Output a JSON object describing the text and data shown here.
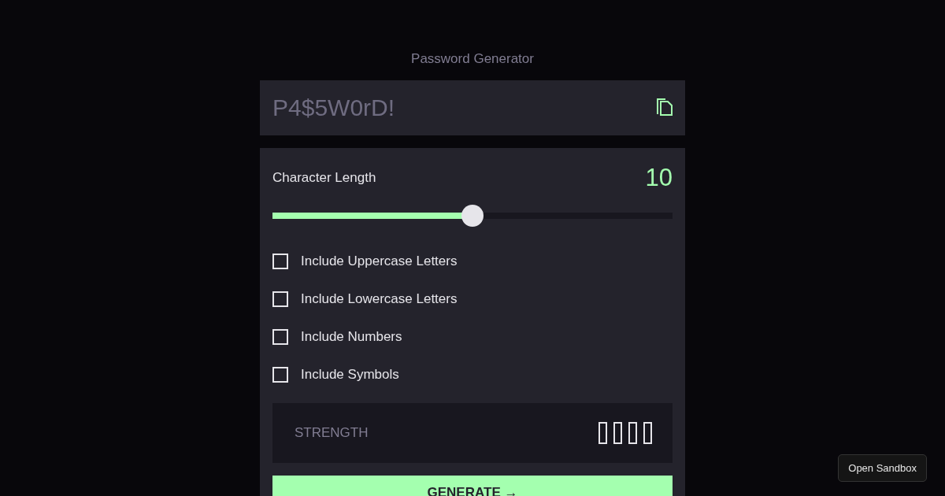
{
  "title": "Password Generator",
  "password": {
    "value": "P4$5W0rD!"
  },
  "length": {
    "label": "Character Length",
    "value": "10",
    "level": 0.5
  },
  "options": [
    {
      "label": "Include Uppercase Letters",
      "checked": false
    },
    {
      "label": "Include Lowercase Letters",
      "checked": false
    },
    {
      "label": "Include Numbers",
      "checked": false
    },
    {
      "label": "Include Symbols",
      "checked": false
    }
  ],
  "strength": {
    "label": "STRENGTH",
    "bars": [
      {
        "filled": false
      },
      {
        "filled": false
      },
      {
        "filled": false
      },
      {
        "filled": false
      }
    ]
  },
  "generate_button": {
    "label": "GENERATE",
    "arrow": "→"
  },
  "sandbox_button": {
    "label": "Open Sandbox"
  }
}
